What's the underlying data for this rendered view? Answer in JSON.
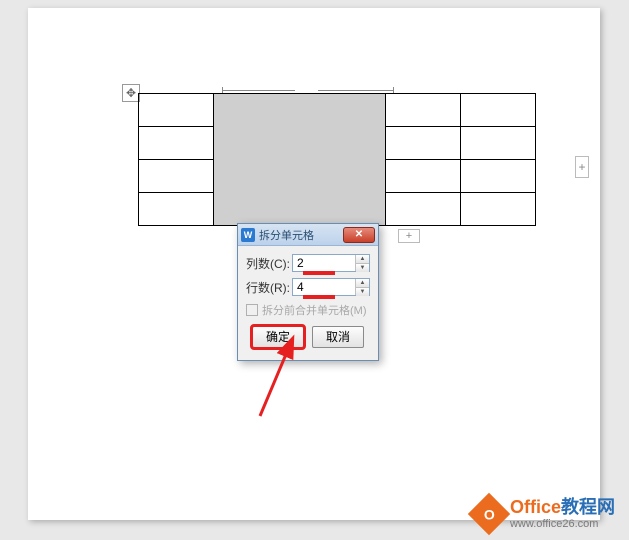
{
  "dialog": {
    "title": "拆分单元格",
    "app_icon": "W",
    "close": "✕",
    "cols_label": "列数(C):",
    "cols_value": "2",
    "rows_label": "行数(R):",
    "rows_value": "4",
    "merge_before_label": "拆分前合并单元格(M)",
    "ok_label": "确定",
    "cancel_label": "取消"
  },
  "handles": {
    "move": "✥",
    "add_right": "+",
    "add_bottom": "+"
  },
  "spin": {
    "up": "▲",
    "down": "▼"
  },
  "watermark": {
    "brand_a": "Office",
    "brand_b": "教程网",
    "url": "www.office26.com",
    "icon_letter": "O"
  }
}
